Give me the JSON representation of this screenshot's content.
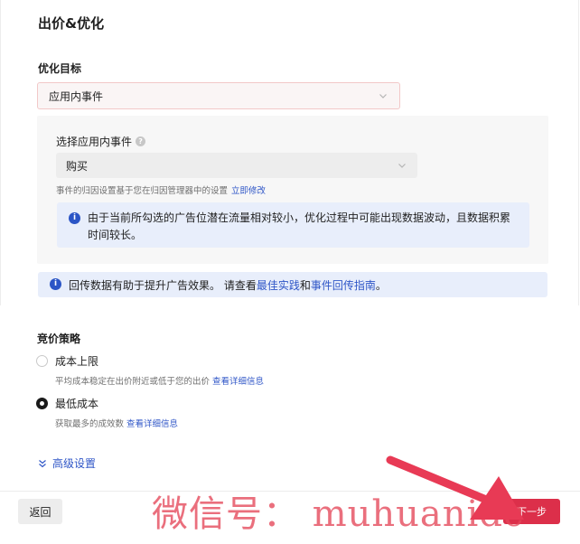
{
  "section": {
    "title": "出价&优化"
  },
  "optimization": {
    "label": "优化目标",
    "goal_value": "应用内事件",
    "event_label": "选择应用内事件",
    "event_value": "购买",
    "attribution_note": "事件的归因设置基于您在归因管理器中的设置",
    "attribution_link": "立即修改",
    "info_text": "由于当前所勾选的广告位潜在流量相对较小，优化过程中可能出现数据波动，且数据积累时间较长。"
  },
  "postback": {
    "prefix": "回传数据有助于提升广告效果。 请查看",
    "link1": "最佳实践",
    "mid": "和",
    "link2": "事件回传指南",
    "suffix": "。"
  },
  "bid": {
    "title": "竞价策略",
    "options": [
      {
        "label": "成本上限",
        "desc": "平均成本稳定在出价附近或低于您的出价",
        "link": "查看详细信息",
        "selected": false
      },
      {
        "label": "最低成本",
        "desc": "获取最多的成效数",
        "link": "查看详细信息",
        "selected": true
      }
    ]
  },
  "advanced": {
    "label": "高级设置"
  },
  "footer": {
    "back_label": "返回",
    "next_label": "下一步"
  },
  "watermark": {
    "text": "微信号： muhuanidc"
  },
  "colors": {
    "accent": "#2f56c7",
    "primary": "#dc2f4a",
    "info_bg": "#e8eefb"
  }
}
